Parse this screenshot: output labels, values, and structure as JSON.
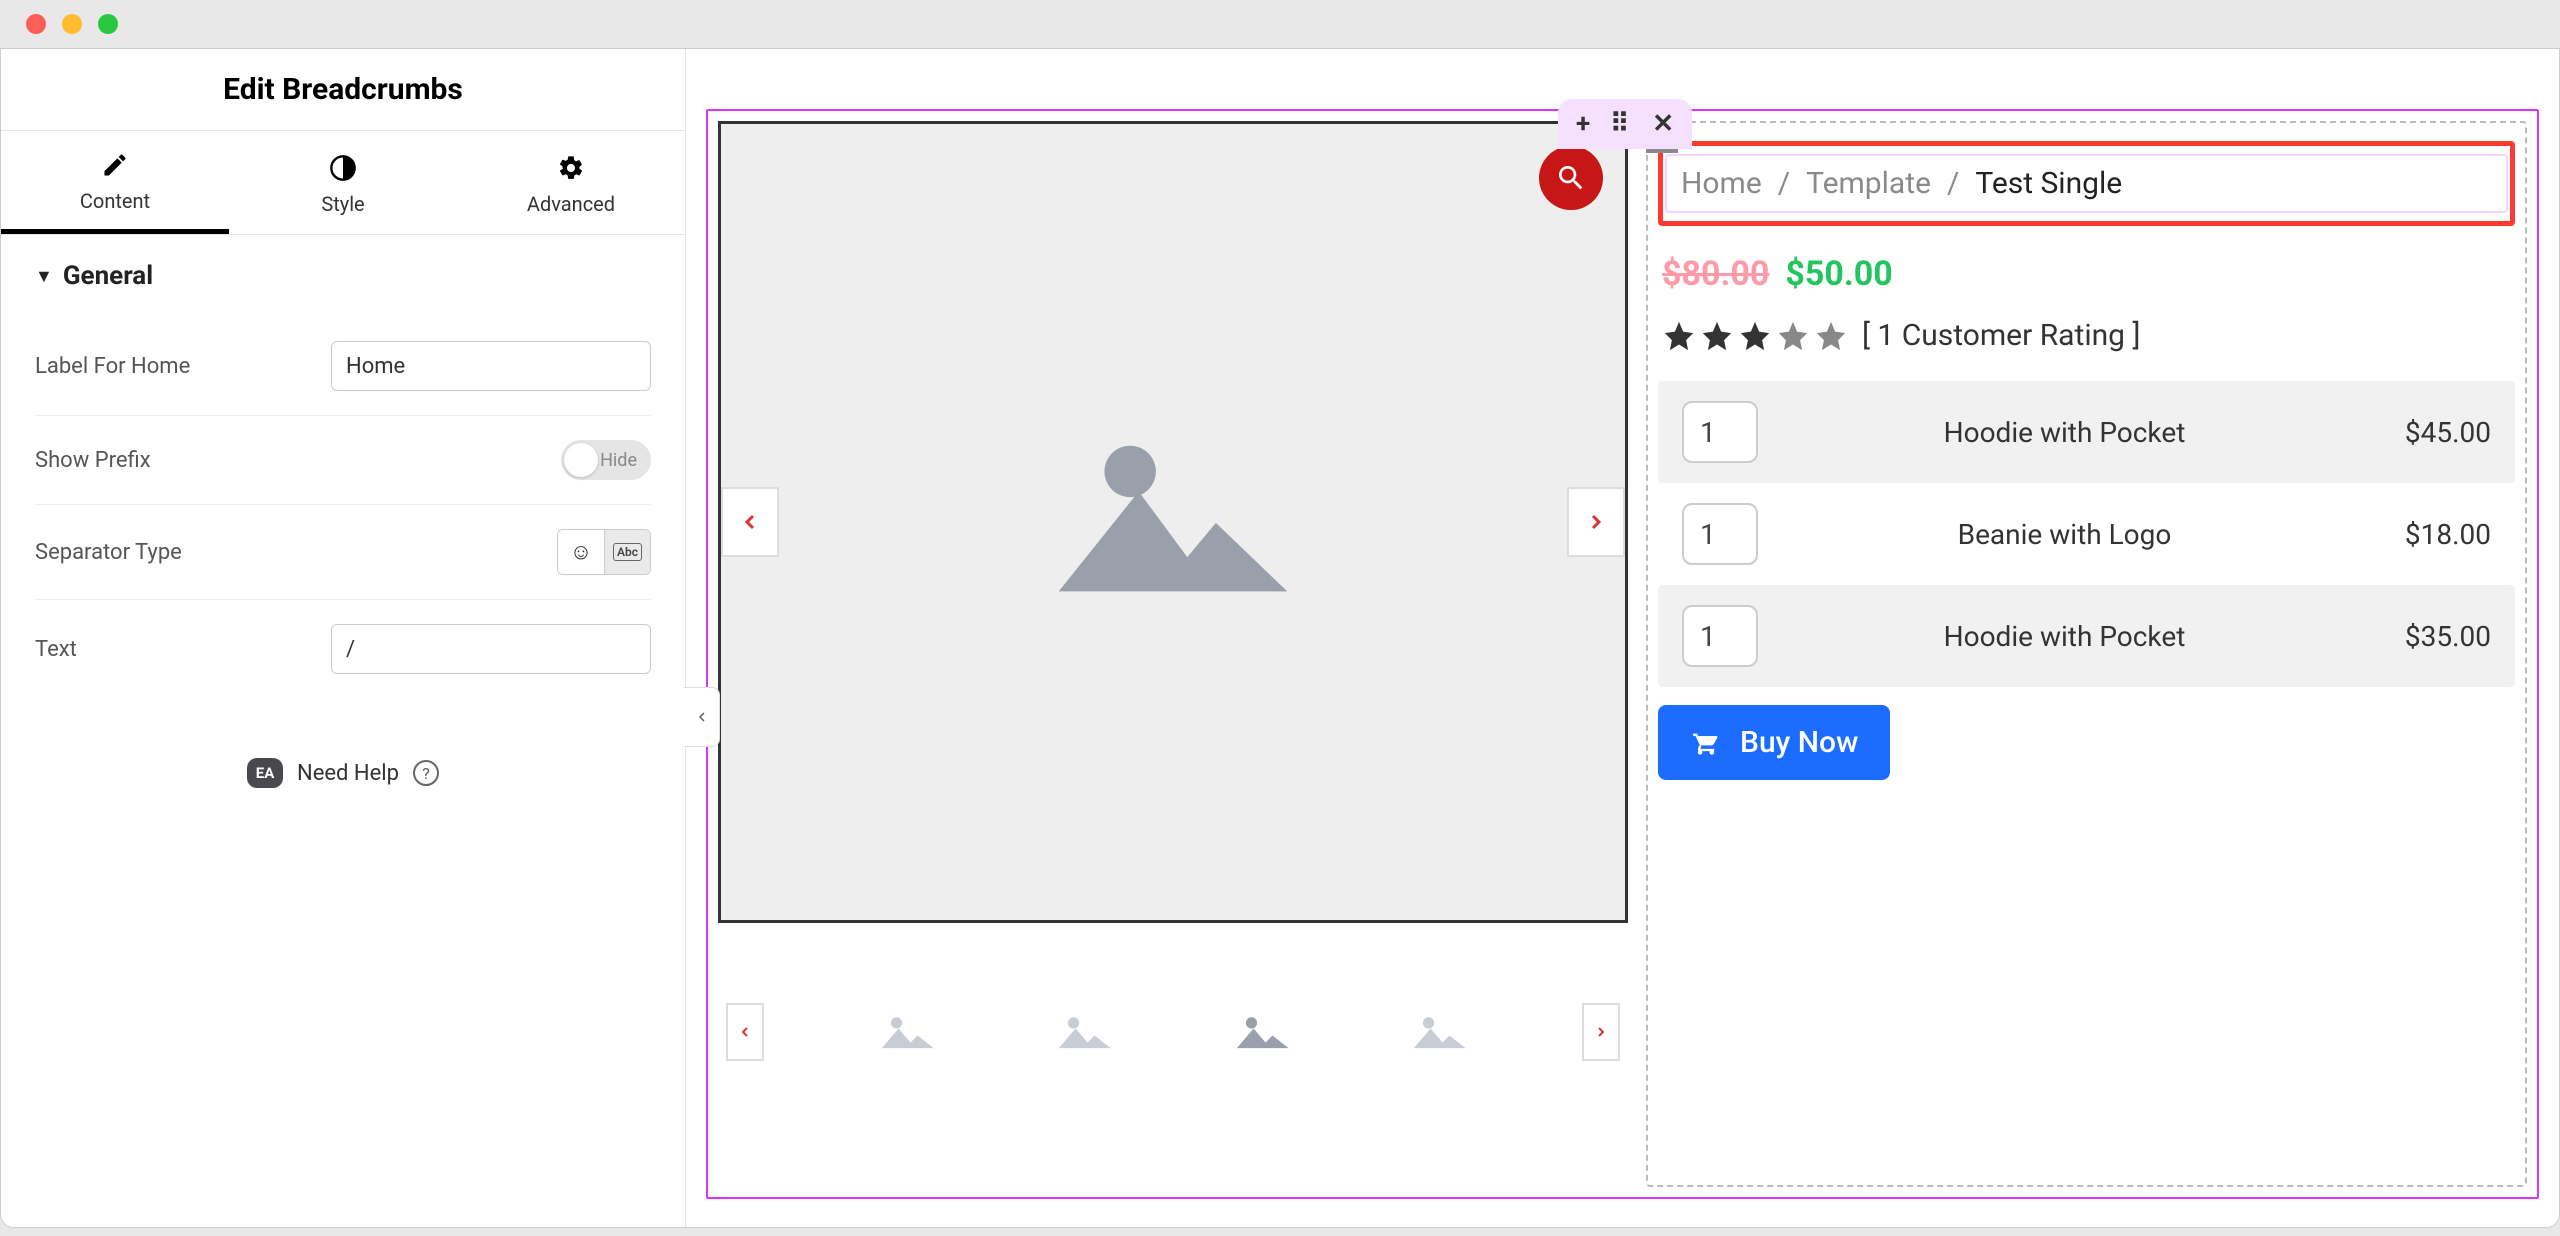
{
  "panel": {
    "title": "Edit Breadcrumbs",
    "tabs": {
      "content": "Content",
      "style": "Style",
      "advanced": "Advanced"
    },
    "section": "General",
    "controls": {
      "labelForHome": {
        "label": "Label For Home",
        "value": "Home"
      },
      "showPrefix": {
        "label": "Show Prefix",
        "state": "Hide"
      },
      "separatorType": {
        "label": "Separator Type"
      },
      "text": {
        "label": "Text",
        "value": "/"
      }
    },
    "help": "Need Help",
    "ea": "EA"
  },
  "breadcrumb": {
    "items": [
      "Home",
      "Template",
      "Test Single"
    ],
    "sep": "/"
  },
  "price": {
    "old": "$80.00",
    "new": "$50.00"
  },
  "rating": {
    "filled": 3,
    "text": "[ 1 Customer Rating ]"
  },
  "bundle": [
    {
      "qty": "1",
      "name": "Hoodie with Pocket",
      "price": "$45.00"
    },
    {
      "qty": "1",
      "name": "Beanie with Logo",
      "price": "$18.00"
    },
    {
      "qty": "1",
      "name": "Hoodie with Pocket",
      "price": "$35.00"
    }
  ],
  "buy": "Buy Now"
}
